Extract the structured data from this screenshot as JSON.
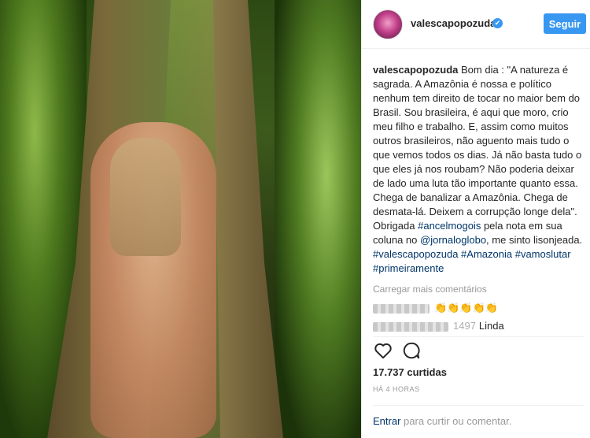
{
  "post": {
    "username": "valescapopozuda",
    "verified_mark": "✔",
    "follow_label": "Seguir"
  },
  "caption": {
    "username": "valescapopozuda",
    "text": "Bom dia : \"A natureza é sagrada. A Amazônia é nossa e político nenhum tem direito de tocar no maior bem do Brasil. Sou brasileira, é aqui que moro, crio meu filho e trabalho. E, assim como muitos outros brasileiros, não aguento mais tudo o que vemos todos os dias. Já não basta tudo o que eles já nos roubam? Não poderia deixar de lado uma luta tão importante quanto essa. Chega de banalizar a Amazônia. Chega de desmata-lá. Deixem a corrupção longe dela\". Obrigada",
    "mention1": "#ancelmogois",
    "text2": "pela nota em sua coluna no",
    "mention2": "@jornaloglobo",
    "text3": ", me sinto lisonjeada.",
    "hashtags": [
      "#valescapopozuda",
      "#Amazonia",
      "#vamoslutar",
      "#primeiramente"
    ]
  },
  "comments": {
    "load_more": "Carregar mais comentários",
    "c1_text": "👏👏👏👏👏",
    "c2_user_suffix": "1497",
    "c2_text": "Linda"
  },
  "actions": {
    "like_icon": "heart-icon",
    "comment_icon": "comment-icon"
  },
  "stats": {
    "likes": "17.737 curtidas",
    "time": "HÁ 4 HORAS"
  },
  "login": {
    "link": "Entrar",
    "text": "para curtir ou comentar."
  },
  "colors": {
    "accent": "#3897f0",
    "link": "#003569",
    "muted": "#999999"
  }
}
